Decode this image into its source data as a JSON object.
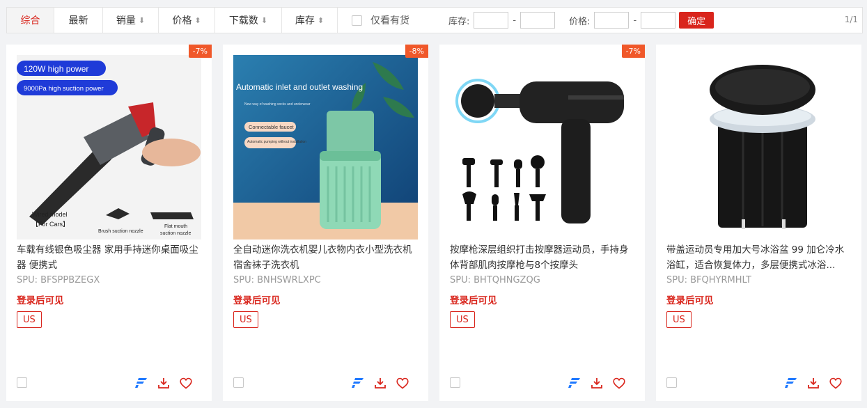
{
  "toolbar": {
    "tabs": [
      {
        "label": "综合",
        "arrow": ""
      },
      {
        "label": "最新",
        "arrow": ""
      },
      {
        "label": "销量",
        "arrow": "⬇"
      },
      {
        "label": "价格",
        "arrow": "⬍"
      },
      {
        "label": "下载数",
        "arrow": "⬇"
      },
      {
        "label": "库存",
        "arrow": "⬍"
      }
    ],
    "in_stock_label": "仅看有货",
    "stock_label": "库存:",
    "price_label": "价格:",
    "dash": "-",
    "confirm_label": "确定",
    "pager": "1/1"
  },
  "products": [
    {
      "discount": "-7%",
      "title": "车载有线银色吸尘器 家用手持迷你桌面吸尘器 便携式",
      "spu": "SPU: BFSPPBZEGX",
      "login_text": "登录后可见",
      "market": "US",
      "image_texts": [
        "120W high power",
        "9000Pa high suction power",
        "Wired model",
        "【For Cars】",
        "Brush suction nozzle",
        "Flat mouth",
        "suction nozzle"
      ]
    },
    {
      "discount": "-8%",
      "title": "全自动迷你洗衣机婴儿衣物内衣小型洗衣机宿舍袜子洗衣机",
      "spu": "SPU: BNHSWRLXPC",
      "login_text": "登录后可见",
      "market": "US",
      "image_texts": [
        "Automatic inlet and outlet washing",
        "New way of washing socks and underwear",
        "Connectable faucet",
        "Automatic pumping without installation"
      ]
    },
    {
      "discount": "-7%",
      "title": "按摩枪深层组织打击按摩器运动员，手持身体背部肌肉按摩枪与8个按摩头",
      "spu": "SPU: BHTQHNGZQG",
      "login_text": "登录后可见",
      "market": "US",
      "image_texts": []
    },
    {
      "discount": "",
      "title": "带盖运动员专用加大号冰浴盆 99 加仑冷水浴缸，适合恢复体力，多层便携式冰浴...",
      "spu": "SPU: BFQHYRMHLT",
      "login_text": "登录后可见",
      "market": "US",
      "image_texts": []
    }
  ],
  "colors": {
    "accent": "#d9251c",
    "discount": "#f0582a",
    "brand_icon": "#1e78ff"
  },
  "icons": [
    "brand-f-icon",
    "download-icon",
    "heart-icon"
  ]
}
